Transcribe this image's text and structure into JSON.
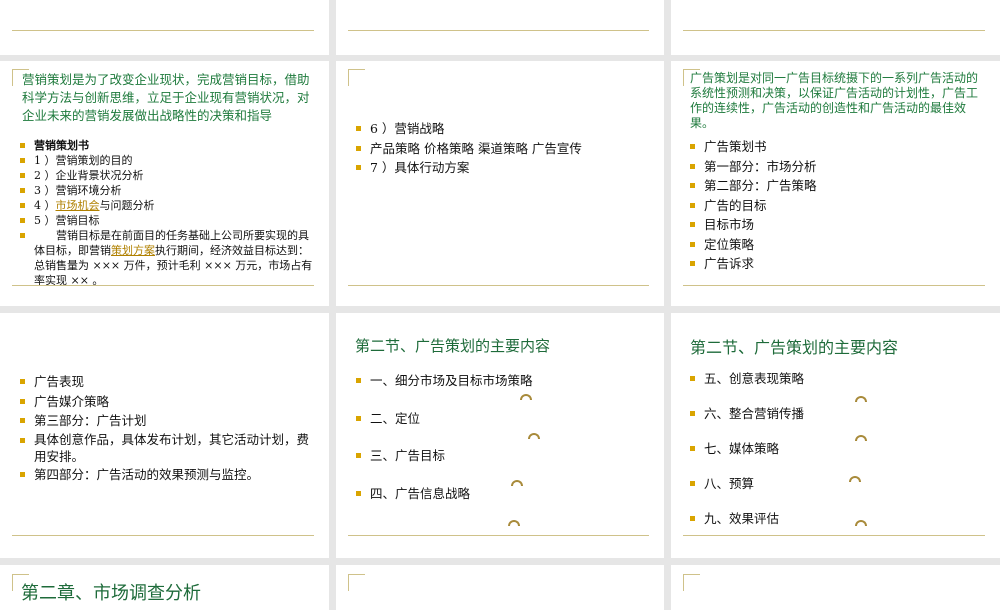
{
  "slide_a": {
    "intro": "营销策划是为了改变企业现状，完成营销目标，借助科学方法与创新思维，立足于企业现有营销状况，对企业未来的营销发展做出战略性的决策和指导",
    "items": [
      {
        "text": "营销策划书"
      },
      {
        "text": "1 ）营销策划的目的"
      },
      {
        "text": "2 ）企业背景状况分析"
      },
      {
        "text": "3 ）营销环境分析"
      },
      {
        "pre": "4 ）",
        "link": "市场机会",
        "post": "与问题分析"
      },
      {
        "text": "5 ）营销目标"
      },
      {
        "pre": "　　营销目标是在前面目的任务基础上公司所要实现的具体目标，即营销",
        "link": "策划方案",
        "post": "执行期间，经济效益目标达到：总销售量为 ××× 万件，预计毛利 ××× 万元，市场占有率实现 ×× 。"
      }
    ]
  },
  "slide_b": {
    "items": [
      "6 ）营销战略",
      "产品策略  价格策略  渠道策略  广告宣传",
      "7 ）具体行动方案"
    ]
  },
  "slide_c": {
    "intro": "广告策划是对同一广告目标统摄下的一系列广告活动的系统性预测和决策，以保证广告活动的计划性，广告工作的连续性，广告活动的创造性和广告活动的最佳效果。",
    "items": [
      "广告策划书",
      "第一部分：市场分析",
      "第二部分：广告策略",
      "广告的目标",
      "目标市场",
      "定位策略",
      "广告诉求"
    ]
  },
  "slide_d": {
    "items": [
      "广告表现",
      "广告媒介策略",
      "第三部分：广告计划",
      "具体创意作品，具体发布计划，其它活动计划，费用安排。",
      "第四部分：广告活动的效果预测与监控。"
    ]
  },
  "slide_e": {
    "title": "第二节、广告策划的主要内容",
    "items": [
      "一、细分市场及目标市场策略",
      "二、定位",
      "三、广告目标",
      "四、广告信息战略"
    ]
  },
  "slide_f": {
    "title": "第二节、广告策划的主要内容",
    "items": [
      "五、创意表现策略",
      "六、整合营销传播",
      "七、媒体策略",
      "八、预算",
      "九、效果评估"
    ]
  },
  "slide_g": {
    "title": "第二章、市场调查分析"
  }
}
